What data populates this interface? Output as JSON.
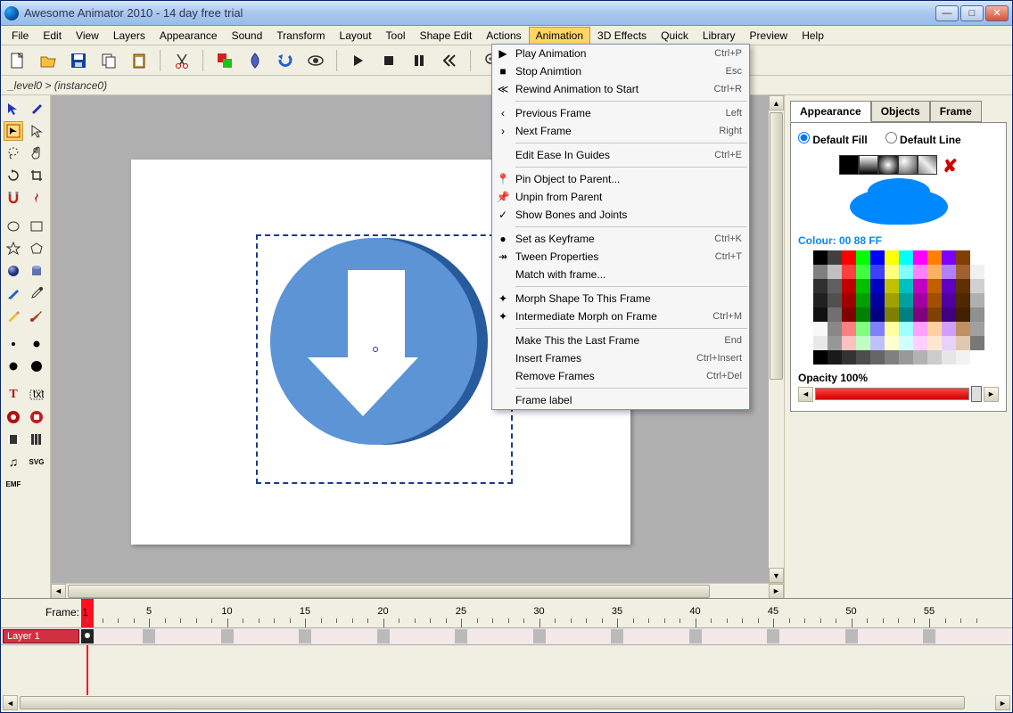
{
  "titlebar": {
    "title": "Awesome Animator 2010 - 14 day free trial"
  },
  "menubar": {
    "items": [
      "File",
      "Edit",
      "View",
      "Layers",
      "Appearance",
      "Sound",
      "Transform",
      "Layout",
      "Tool",
      "Shape Edit",
      "Actions",
      "Animation",
      "3D Effects",
      "Quick",
      "Library",
      "Preview",
      "Help"
    ],
    "active": "Animation"
  },
  "breadcrumb": "_level0 > (instance0)",
  "dropdown": {
    "groups": [
      [
        {
          "icon": "▶",
          "label": "Play Animation",
          "accel": "Ctrl+P"
        },
        {
          "icon": "■",
          "label": "Stop Animtion",
          "accel": "Esc"
        },
        {
          "icon": "≪",
          "label": "Rewind Animation to Start",
          "accel": "Ctrl+R"
        }
      ],
      [
        {
          "icon": "‹",
          "label": "Previous Frame",
          "accel": "Left"
        },
        {
          "icon": "›",
          "label": "Next Frame",
          "accel": "Right"
        }
      ],
      [
        {
          "icon": "",
          "label": "Edit Ease In Guides",
          "accel": "Ctrl+E"
        }
      ],
      [
        {
          "icon": "📍",
          "label": "Pin Object to Parent...",
          "accel": ""
        },
        {
          "icon": "📌",
          "label": "Unpin from Parent",
          "accel": ""
        },
        {
          "icon": "✓",
          "label": "Show Bones and Joints",
          "accel": ""
        }
      ],
      [
        {
          "icon": "●",
          "label": "Set as Keyframe",
          "accel": "Ctrl+K"
        },
        {
          "icon": "↠",
          "label": "Tween Properties",
          "accel": "Ctrl+T"
        },
        {
          "icon": "",
          "label": "Match with frame...",
          "accel": ""
        }
      ],
      [
        {
          "icon": "✦",
          "label": "Morph Shape To This Frame",
          "accel": ""
        },
        {
          "icon": "✦",
          "label": "Intermediate Morph on Frame",
          "accel": "Ctrl+M"
        }
      ],
      [
        {
          "icon": "",
          "label": "Make This the Last Frame",
          "accel": "End"
        },
        {
          "icon": "",
          "label": "Insert Frames",
          "accel": "Ctrl+Insert"
        },
        {
          "icon": "",
          "label": "Remove Frames",
          "accel": "Ctrl+Del"
        }
      ],
      [
        {
          "icon": "",
          "label": "Frame label",
          "accel": ""
        }
      ]
    ]
  },
  "appearance": {
    "tabs": [
      "Appearance",
      "Objects",
      "Frame"
    ],
    "active_tab": "Appearance",
    "radio_fill": "Default Fill",
    "radio_line": "Default Line",
    "colour_label": "Colour: 00 88 FF",
    "opacity_label": "Opacity 100%"
  },
  "timeline": {
    "frame_label": "Frame:",
    "current_frame": "1",
    "layer_name": "Layer 1",
    "ticks": [
      5,
      10,
      15,
      20,
      25,
      30,
      35,
      40,
      45,
      50,
      55
    ]
  },
  "palette_colors": [
    "#000000",
    "#404040",
    "#ff0000",
    "#00ff00",
    "#0000ff",
    "#ffff00",
    "#00ffff",
    "#ff00ff",
    "#ff8000",
    "#8000ff",
    "#804000",
    "#ffffff",
    "#808080",
    "#c0c0c0",
    "#ff4040",
    "#40ff40",
    "#4040ff",
    "#ffff80",
    "#80ffff",
    "#ff80ff",
    "#ffb060",
    "#b080ff",
    "#a06030",
    "#f0f0f0",
    "#303030",
    "#606060",
    "#c00000",
    "#00c000",
    "#0000c0",
    "#c0c000",
    "#00c0c0",
    "#c000c0",
    "#c06000",
    "#6000c0",
    "#603000",
    "#d0d0d0",
    "#202020",
    "#505050",
    "#a00000",
    "#00a000",
    "#0000a0",
    "#a0a000",
    "#00a0a0",
    "#a000a0",
    "#a05000",
    "#5000a0",
    "#502800",
    "#b0b0b0",
    "#101010",
    "#707070",
    "#800000",
    "#008000",
    "#000080",
    "#808000",
    "#008080",
    "#800080",
    "#804000",
    "#400080",
    "#402000",
    "#909090",
    "#f8f8f8",
    "#888888",
    "#ff8080",
    "#80ff80",
    "#8080ff",
    "#ffffa0",
    "#a0ffff",
    "#ffa0ff",
    "#ffd0a0",
    "#d0a0ff",
    "#c09060",
    "#a0a0a0",
    "#e8e8e8",
    "#989898",
    "#ffc0c0",
    "#c0ffc0",
    "#c0c0ff",
    "#ffffd0",
    "#d0ffff",
    "#ffd0ff",
    "#ffe8d0",
    "#e8d0ff",
    "#e0c8b0",
    "#787878",
    "#000000",
    "#1a1a1a",
    "#333333",
    "#4d4d4d",
    "#666666",
    "#808080",
    "#999999",
    "#b3b3b3",
    "#cccccc",
    "#e6e6e6",
    "#f2f2f2",
    "#ffffff"
  ]
}
